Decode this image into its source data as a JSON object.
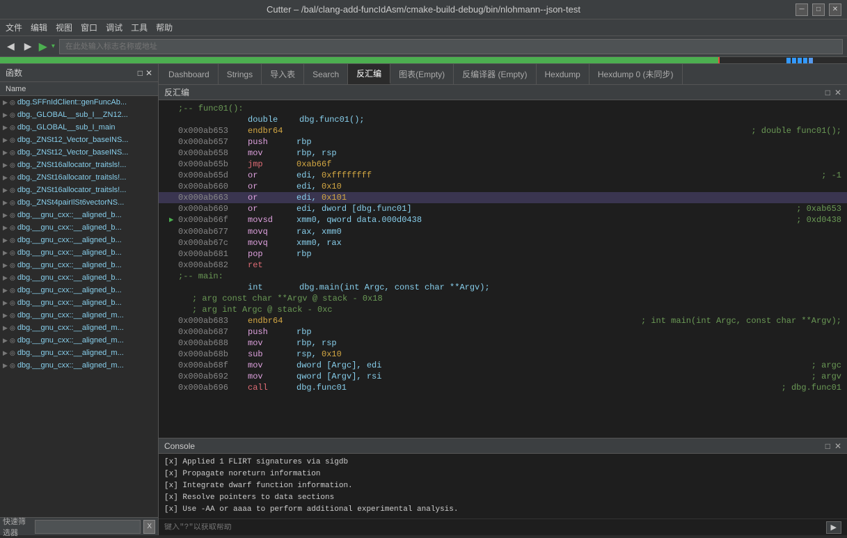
{
  "titleBar": {
    "title": "Cutter – /bal/clang-add-funcIdAsm/cmake-build-debug/bin/nlohmann--json-test",
    "minimize": "─",
    "maximize": "□",
    "close": "✕"
  },
  "menuBar": {
    "items": [
      "文件",
      "编辑",
      "视图",
      "窗口",
      "调试",
      "工具",
      "帮助"
    ]
  },
  "toolbar": {
    "back": "◀",
    "forward": "▶",
    "play": "▶",
    "playDropdown": "▾",
    "addressPlaceholder": "在此处输入标志名称或地址"
  },
  "sidebar": {
    "header": "函数",
    "columnName": "Name",
    "items": [
      "dbg.SFFnIdClient::genFuncAb...",
      "dbg._GLOBAL__sub_I__ZN12...",
      "dbg._GLOBAL__sub_I_main",
      "dbg._ZNSt12_Vector_baseINS...",
      "dbg._ZNSt12_Vector_baseINS...",
      "dbg._ZNSt16allocator_traitsls!...",
      "dbg._ZNSt16allocator_traitsls!...",
      "dbg._ZNSt16allocator_traitsls!...",
      "dbg._ZNSt4pairIlSt6vectorNS...",
      "dbg.__gnu_cxx::__aligned_b...",
      "dbg.__gnu_cxx::__aligned_b...",
      "dbg.__gnu_cxx::__aligned_b...",
      "dbg.__gnu_cxx::__aligned_b...",
      "dbg.__gnu_cxx::__aligned_b...",
      "dbg.__gnu_cxx::__aligned_b...",
      "dbg.__gnu_cxx::__aligned_b...",
      "dbg.__gnu_cxx::__aligned_b...",
      "dbg.__gnu_cxx::__aligned_m...",
      "dbg.__gnu_cxx::__aligned_m...",
      "dbg.__gnu_cxx::__aligned_m...",
      "dbg.__gnu_cxx::__aligned_m...",
      "dbg.__gnu_cxx::__aligned_m..."
    ],
    "quickFilterLabel": "快速筛选器",
    "quickFilterPlaceholder": "",
    "clearBtn": "X"
  },
  "tabs": [
    {
      "label": "Dashboard",
      "active": false
    },
    {
      "label": "Strings",
      "active": false
    },
    {
      "label": "导入表",
      "active": false
    },
    {
      "label": "Search",
      "active": false
    },
    {
      "label": "反汇编",
      "active": true
    },
    {
      "label": "图表(Empty)",
      "active": false
    },
    {
      "label": "反编译器 (Empty)",
      "active": false
    },
    {
      "label": "Hexdump",
      "active": false
    },
    {
      "label": "Hexdump 0 (未同步)",
      "active": false
    }
  ],
  "disasmHeader": "反汇编",
  "disasmLines": [
    {
      "type": "comment",
      "text": ";-- func01():"
    },
    {
      "type": "code",
      "addr": "",
      "mnemonic": "double",
      "operands": "dbg.func01();",
      "comment": "",
      "highlight": false,
      "arrow": false,
      "indent": 4
    },
    {
      "type": "code",
      "addr": "0x000ab653",
      "mnemonic": "endbr64",
      "operands": "",
      "comment": "; double func01();",
      "highlight": false,
      "arrow": false
    },
    {
      "type": "code",
      "addr": "0x000ab657",
      "mnemonic": "push",
      "operands": "rbp",
      "comment": "",
      "highlight": false,
      "arrow": false
    },
    {
      "type": "code",
      "addr": "0x000ab658",
      "mnemonic": "mov",
      "operands": "rbp, rsp",
      "comment": "",
      "highlight": false,
      "arrow": false
    },
    {
      "type": "code",
      "addr": "0x000ab65b",
      "mnemonic": "jmp",
      "operands": "0xab66f",
      "comment": "",
      "highlight": false,
      "arrow": false,
      "operandColor": "orange"
    },
    {
      "type": "code",
      "addr": "0x000ab65d",
      "mnemonic": "or",
      "operands": "edi, 0xffffffff",
      "comment": "; -1",
      "highlight": false,
      "arrow": false
    },
    {
      "type": "code",
      "addr": "0x000ab660",
      "mnemonic": "or",
      "operands": "edi, 0x10",
      "comment": "",
      "highlight": false,
      "arrow": false
    },
    {
      "type": "code",
      "addr": "0x000ab663",
      "mnemonic": "or",
      "operands": "edi, 0x101",
      "comment": "",
      "highlight": true,
      "arrow": false
    },
    {
      "type": "code",
      "addr": "0x000ab669",
      "mnemonic": "or",
      "operands": "edi, dword [dbg.func01]",
      "comment": "; 0xab653",
      "highlight": false,
      "arrow": false
    },
    {
      "type": "code",
      "addr": "0x000ab66f",
      "mnemonic": "movsd",
      "operands": "xmm0, qword data.000d0438",
      "comment": "; 0xd0438",
      "highlight": false,
      "arrow": true
    },
    {
      "type": "code",
      "addr": "0x000ab677",
      "mnemonic": "movq",
      "operands": "rax, xmm0",
      "comment": "",
      "highlight": false,
      "arrow": false
    },
    {
      "type": "code",
      "addr": "0x000ab67c",
      "mnemonic": "movq",
      "operands": "xmm0, rax",
      "comment": "",
      "highlight": false,
      "arrow": false
    },
    {
      "type": "code",
      "addr": "0x000ab681",
      "mnemonic": "pop",
      "operands": "rbp",
      "comment": "",
      "highlight": false,
      "arrow": false
    },
    {
      "type": "code",
      "addr": "0x000ab682",
      "mnemonic": "ret",
      "operands": "",
      "comment": "",
      "highlight": false,
      "arrow": false
    },
    {
      "type": "comment",
      "text": ";-- main:"
    },
    {
      "type": "code",
      "addr": "",
      "mnemonic": "int",
      "operands": "dbg.main(int Argc, const char **Argv);",
      "comment": "",
      "highlight": false,
      "arrow": false,
      "indent": 4
    },
    {
      "type": "comment2",
      "text": "; arg const char **Argv @ stack - 0x18"
    },
    {
      "type": "comment2",
      "text": "; arg int Argc @ stack - 0xc"
    },
    {
      "type": "code",
      "addr": "0x000ab683",
      "mnemonic": "endbr64",
      "operands": "",
      "comment": "; int main(int Argc, const char **Argv);",
      "highlight": false,
      "arrow": false
    },
    {
      "type": "code",
      "addr": "0x000ab687",
      "mnemonic": "push",
      "operands": "rbp",
      "comment": "",
      "highlight": false,
      "arrow": false
    },
    {
      "type": "code",
      "addr": "0x000ab688",
      "mnemonic": "mov",
      "operands": "rbp, rsp",
      "comment": "",
      "highlight": false,
      "arrow": false
    },
    {
      "type": "code",
      "addr": "0x000ab68b",
      "mnemonic": "sub",
      "operands": "rsp, 0x10",
      "comment": "",
      "highlight": false,
      "arrow": false
    },
    {
      "type": "code",
      "addr": "0x000ab68f",
      "mnemonic": "mov",
      "operands": "dword [Argc], edi",
      "comment": "; argc",
      "highlight": false,
      "arrow": false
    },
    {
      "type": "code",
      "addr": "0x000ab692",
      "mnemonic": "mov",
      "operands": "qword [Argv], rsi",
      "comment": "; argv",
      "highlight": false,
      "arrow": false
    },
    {
      "type": "code",
      "addr": "0x000ab696",
      "mnemonic": "call",
      "operands": "dbg.func01",
      "comment": "; dbg.func01",
      "highlight": false,
      "arrow": false
    }
  ],
  "console": {
    "header": "Console",
    "lines": [
      "[x] Applied 1 FLIRT signatures via sigdb",
      "[x] Propagate noreturn information",
      "[x] Integrate dwarf function information.",
      "[x] Resolve pointers to data sections",
      "[x] Use -AA or aaaa to perform additional experimental analysis."
    ],
    "inputPlaceholder": "键入\"?\"以获取帮助"
  }
}
